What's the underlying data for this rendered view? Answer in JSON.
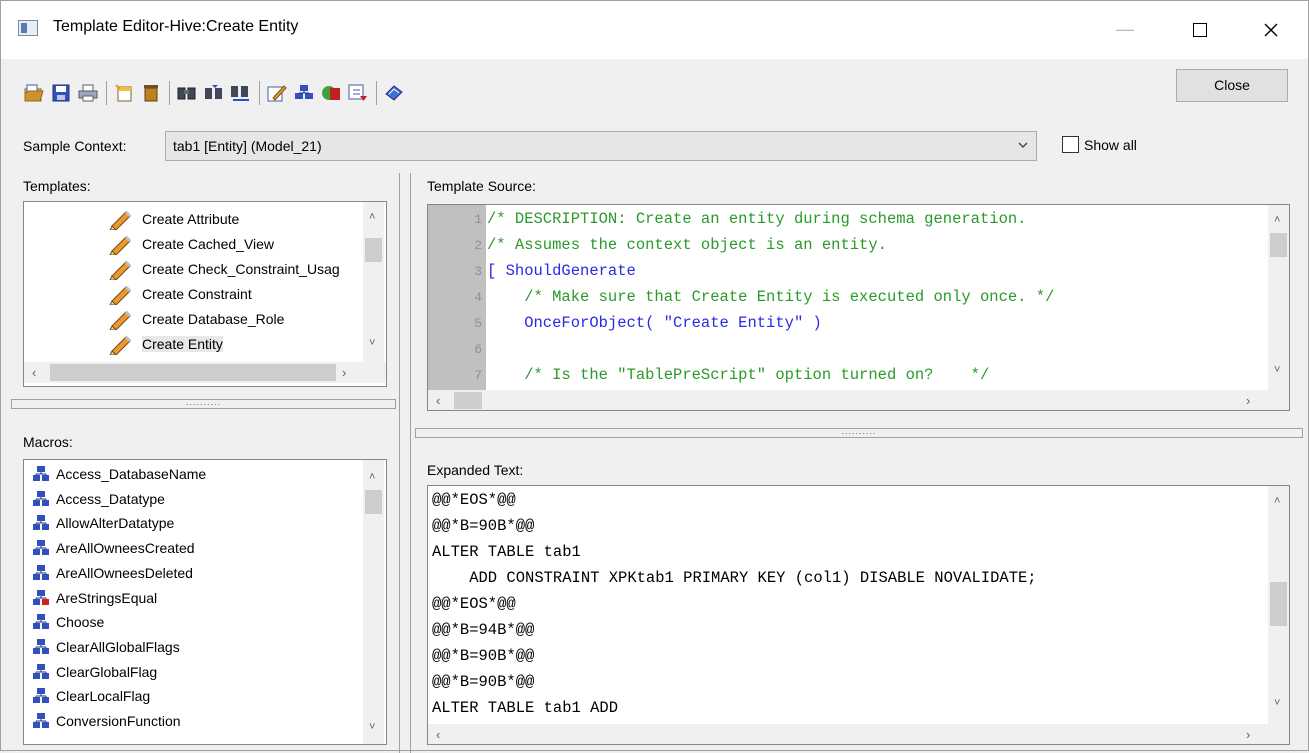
{
  "window": {
    "title": "Template Editor-Hive:Create Entity"
  },
  "toolbar": {
    "icons": [
      "open-icon",
      "save-icon",
      "print-icon",
      "new-icon",
      "delete-icon",
      "find-icon",
      "find-next-icon",
      "replace-icon",
      "edit-icon",
      "macro-icon",
      "expand-icon",
      "insert-icon",
      "help-icon"
    ],
    "close_label": "Close"
  },
  "sample_context": {
    "label": "Sample Context:",
    "value": "tab1 [Entity] (Model_21)",
    "show_all_label": "Show all",
    "show_all_checked": false
  },
  "templates": {
    "label": "Templates:",
    "items": [
      "Create Attribute",
      "Create Cached_View",
      "Create Check_Constraint_Usag",
      "Create Constraint",
      "Create Database_Role",
      "Create Entity"
    ],
    "selected": "Create Entity"
  },
  "macros": {
    "label": "Macros:",
    "items": [
      "Access_DatabaseName",
      "Access_Datatype",
      "AllowAlterDatatype",
      "AreAllOwneesCreated",
      "AreAllOwneesDeleted",
      "AreStringsEqual",
      "Choose",
      "ClearAllGlobalFlags",
      "ClearGlobalFlag",
      "ClearLocalFlag",
      "ConversionFunction"
    ]
  },
  "template_source": {
    "label": "Template Source:",
    "lines": [
      {
        "num": "1",
        "text": "/* DESCRIPTION: Create an entity during schema generation.",
        "color": "#2a9a2a"
      },
      {
        "num": "2",
        "text": "/* Assumes the context object is an entity.",
        "color": "#2a9a2a"
      },
      {
        "num": "3",
        "text": "[ ShouldGenerate",
        "color": "#2a2ae0"
      },
      {
        "num": "4",
        "text": "    /* Make sure that Create Entity is executed only once. */",
        "color": "#2a9a2a"
      },
      {
        "num": "5",
        "text": "    OnceForObject( \"Create Entity\" )",
        "color": "#2a2ae0"
      },
      {
        "num": "6",
        "text": "",
        "color": "#000000"
      },
      {
        "num": "7",
        "text": "    /* Is the \"TablePreScript\" option turned on?    */",
        "color": "#2a9a2a"
      }
    ]
  },
  "expanded_text": {
    "label": "Expanded Text:",
    "lines": [
      "@@*EOS*@@",
      "@@*B=90B*@@",
      "ALTER TABLE tab1",
      "    ADD CONSTRAINT XPKtab1 PRIMARY KEY (col1) DISABLE NOVALIDATE;",
      "@@*EOS*@@",
      "@@*B=94B*@@",
      "@@*B=90B*@@",
      "@@*B=90B*@@",
      "ALTER TABLE tab1 ADD"
    ]
  }
}
